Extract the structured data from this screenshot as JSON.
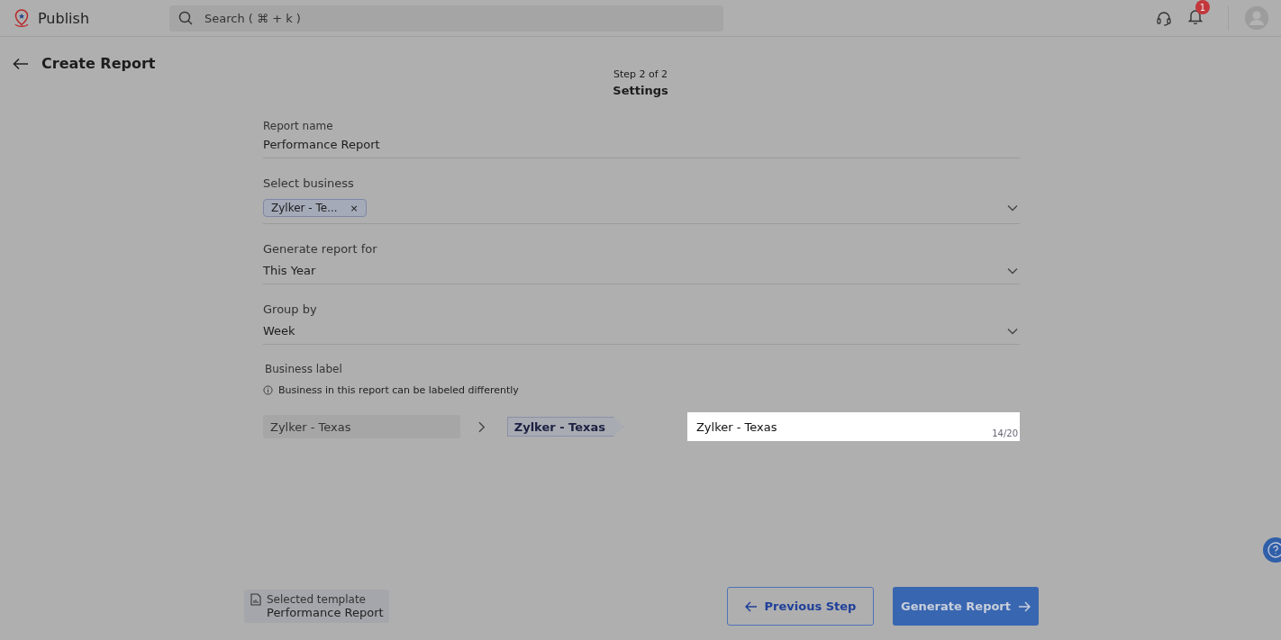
{
  "app": {
    "name": "Publish"
  },
  "search": {
    "placeholder": "Search ( ⌘ + k )"
  },
  "notifications": {
    "count": "1"
  },
  "page": {
    "title": "Create Report"
  },
  "stepper": {
    "step": "Step 2 of 2",
    "name": "Settings"
  },
  "fields": [
    {
      "kind": "text",
      "label": "Report name",
      "value": "Performance Report"
    },
    {
      "kind": "tags",
      "label": "Select business",
      "tags": [
        {
          "label": "Zylker - Te...",
          "remove": "×"
        }
      ]
    },
    {
      "kind": "select",
      "label": "Generate report for",
      "value": "This Year"
    },
    {
      "kind": "select",
      "label": "Group by",
      "value": "Week"
    }
  ],
  "business_label": {
    "label": "Business label",
    "hint": "Business in this report can be labeled differently",
    "source": "Zylker - Texas",
    "preview": "Zylker - Texas",
    "value": "Zylker - Texas",
    "counter": "14/20"
  },
  "template": {
    "caption": "Selected template",
    "name": "Performance Report"
  },
  "buttons": [
    {
      "kind": "secondary",
      "label": "Previous Step"
    },
    {
      "kind": "primary",
      "label": "Generate Report"
    }
  ]
}
